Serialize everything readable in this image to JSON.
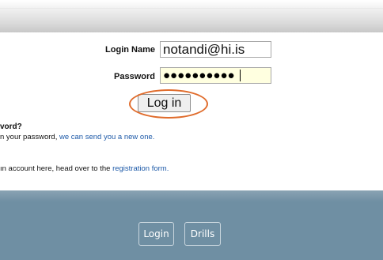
{
  "form": {
    "login_label": "Login Name",
    "login_value": "notandi@hi.is",
    "password_label": "Password",
    "password_masked": "●●●●●●●●●●",
    "submit_label": "Log in"
  },
  "help": {
    "forgot_heading": "vord?",
    "forgot_text_prefix": "n your password, ",
    "forgot_link": "we can send you a new one.",
    "register_text_prefix": "ın account here, head over to the ",
    "register_link": "registration form."
  },
  "nav": {
    "login_label": "Login",
    "drills_label": "Drills"
  },
  "colors": {
    "annotation": "#e06c2c",
    "link": "#1e5aa8",
    "footer": "#6f8fa3",
    "password_field_bg": "#ffffe0"
  }
}
